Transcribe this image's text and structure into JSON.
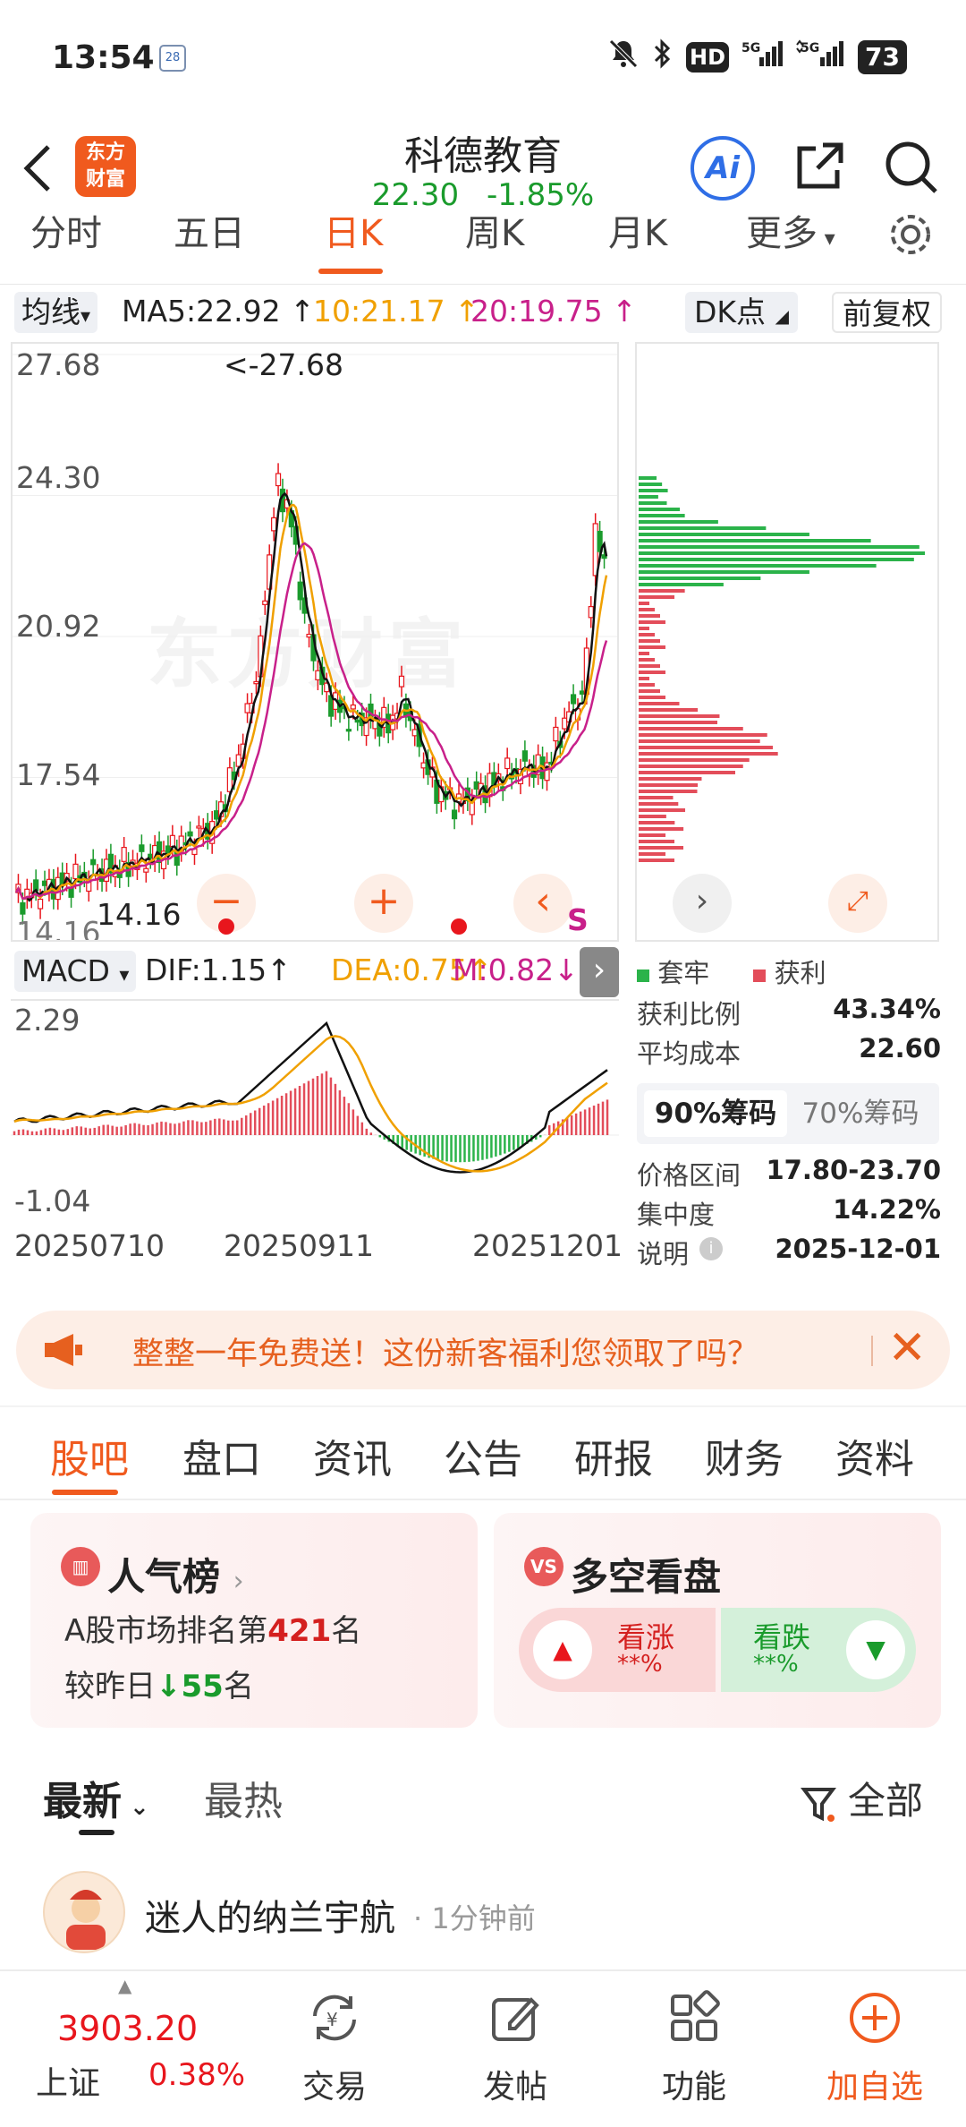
{
  "status_bar": {
    "time": "13:54",
    "calendar_badge": "28",
    "network": "HD",
    "battery": "73"
  },
  "header": {
    "brand_line1": "东方",
    "brand_line2": "财富",
    "stock_name": "科德教育",
    "price": "22.30",
    "change_pct": "-1.85%",
    "ai_label": "Ai"
  },
  "period_tabs": [
    "分时",
    "五日",
    "日K",
    "周K",
    "月K",
    "更多"
  ],
  "active_period": "日K",
  "indicators": {
    "ma_select": "均线",
    "ma5": "MA5:22.92",
    "ma10": "10:21.17",
    "ma20": "20:19.75",
    "dk_select": "DK点",
    "adjust_select": "前复权"
  },
  "kline": {
    "y_labels": [
      "27.68",
      "24.30",
      "20.92",
      "17.54",
      "14.16"
    ],
    "high_marker": "<-27.68",
    "low_marker": "14.16",
    "watermark": "东方财富",
    "sell_marker": "S",
    "colors": {
      "up": "#e8161d",
      "down": "#1a9b2c",
      "ma5": "#111111",
      "ma10": "#f0a000",
      "ma20": "#c8208a"
    }
  },
  "chip": {
    "legend_trapped": "套牢",
    "legend_profit": "获利",
    "stats": [
      {
        "label": "获利比例",
        "value": "43.34%"
      },
      {
        "label": "平均成本",
        "value": "22.60"
      },
      {
        "label": "价格区间",
        "value": "17.80-23.70"
      },
      {
        "label": "集中度",
        "value": "14.22%"
      },
      {
        "label": "说明",
        "value": "2025-12-01"
      }
    ],
    "tab_90": "90%筹码",
    "tab_70": "70%筹码"
  },
  "macd": {
    "select": "MACD",
    "dif": "DIF:1.15",
    "dea": "DEA:0.75",
    "m": "M:0.82",
    "y_top": "2.29",
    "y_bottom": "-1.04",
    "dates": [
      "20250710",
      "20250911",
      "20251201"
    ]
  },
  "promo": {
    "text": "整整一年免费送！这份新客福利您领取了吗？"
  },
  "sub_tabs": [
    "股吧",
    "盘口",
    "资讯",
    "公告",
    "研报",
    "财务",
    "资料"
  ],
  "popularity": {
    "title": "人气榜",
    "rank_prefix": "A股市场排名第",
    "rank": "421",
    "rank_suffix": "名",
    "change_prefix": "较昨日",
    "change": "55",
    "change_suffix": "名"
  },
  "sentiment": {
    "title": "多空看盘",
    "icon_text": "VS",
    "bull_label": "看涨",
    "bull_pct": "**%",
    "bear_label": "看跌",
    "bear_pct": "**%"
  },
  "feed": {
    "tabs": [
      "最新",
      "最热"
    ],
    "filter": "全部",
    "post": {
      "author": "迷人的纳兰宇航",
      "time": "· 1分钟前"
    }
  },
  "bottom_nav": {
    "index_value": "3903.20",
    "index_name": "上证",
    "index_pct": "0.38%",
    "items": [
      "交易",
      "发帖",
      "功能",
      "加自选"
    ]
  }
}
